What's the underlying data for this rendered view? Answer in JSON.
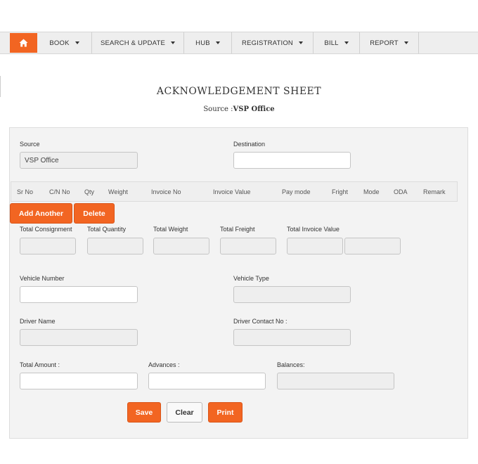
{
  "navbar": {
    "home_icon": "home-icon",
    "items": [
      {
        "label": "BOOK"
      },
      {
        "label": "SEARCH & UPDATE"
      },
      {
        "label": "HUB"
      },
      {
        "label": "REGISTRATION"
      },
      {
        "label": "BILL"
      },
      {
        "label": "REPORT"
      }
    ]
  },
  "page": {
    "title": "ACKNOWLEDGEMENT SHEET",
    "source_prefix": "Source :",
    "source_value": "VSP Office"
  },
  "form": {
    "source_label": "Source",
    "source_value": "VSP Office",
    "destination_label": "Destination",
    "destination_value": "",
    "table_columns": [
      "Sr No",
      "C/N No",
      "Qty",
      "Weight",
      "Invoice No",
      "Invoice Value",
      "Pay mode",
      "Fright",
      "Mode",
      "ODA",
      "Remark"
    ],
    "add_another_label": "Add Another",
    "delete_label": "Delete",
    "total_consignment_label": "Total Consignment",
    "total_quantity_label": "Total Quantity",
    "total_weight_label": "Total Weight",
    "total_freight_label": "Total Freight",
    "total_invoice_value_label": "Total Invoice Value",
    "vehicle_number_label": "Vehicle Number",
    "vehicle_type_label": "Vehicle Type",
    "driver_name_label": "Driver Name",
    "driver_contact_label": "Driver Contact No :",
    "total_amount_label": "Total Amount :",
    "advances_label": "Advances :",
    "balances_label": "Balances:",
    "save_label": "Save",
    "clear_label": "Clear",
    "print_label": "Print"
  },
  "colors": {
    "accent": "#f26522",
    "navbar_bg": "#eeeeee",
    "panel_bg": "#f3f3f3"
  }
}
